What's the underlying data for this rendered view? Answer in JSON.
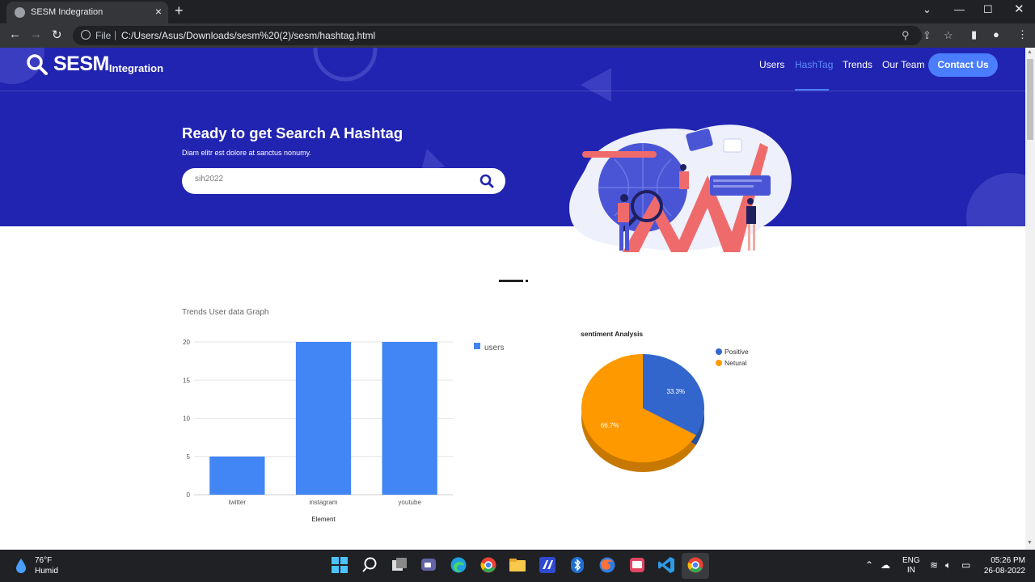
{
  "browser": {
    "tab_title": "SESM Indegration",
    "new_tab": "+",
    "url_prefix": "File",
    "url": "C:/Users/Asus/Downloads/sesm%20(2)/sesm/hashtag.html"
  },
  "site": {
    "logo_main": "SESM",
    "logo_sub": "Integration",
    "nav": [
      "Users",
      "HashTag",
      "Trends",
      "Our Team"
    ],
    "contact_label": "Contact Us"
  },
  "hero": {
    "title": "Ready to get Search A Hashtag",
    "subtitle": "Diam elitr est dolore at sanctus nonumy.",
    "search_value": "sih2022"
  },
  "bar_chart_heading": "Trends User data Graph",
  "chart_data": [
    {
      "type": "bar",
      "title": "Trends User data Graph",
      "categories": [
        "twitter",
        "instagram",
        "youtube"
      ],
      "series": [
        {
          "name": "users",
          "values": [
            5,
            20,
            20
          ]
        }
      ],
      "xlabel": "Element",
      "ylabel": "",
      "ylim": [
        0,
        20
      ],
      "yticks": [
        0,
        5,
        10,
        15,
        20
      ],
      "grid": true,
      "legend": "right",
      "color": "#4285f4"
    },
    {
      "type": "pie",
      "title": "sentiment Analysis",
      "labels": [
        "Positive",
        "Netural"
      ],
      "values": [
        33.3,
        66.7
      ],
      "value_labels": [
        "33.3%",
        "66.7%"
      ],
      "colors": [
        "#3366cc",
        "#ff9900"
      ],
      "legend": "right"
    }
  ],
  "taskbar": {
    "weather_temp": "76°F",
    "weather_desc": "Humid",
    "lang_top": "ENG",
    "lang_bottom": "IN",
    "time": "05:26 PM",
    "date": "26-08-2022"
  }
}
